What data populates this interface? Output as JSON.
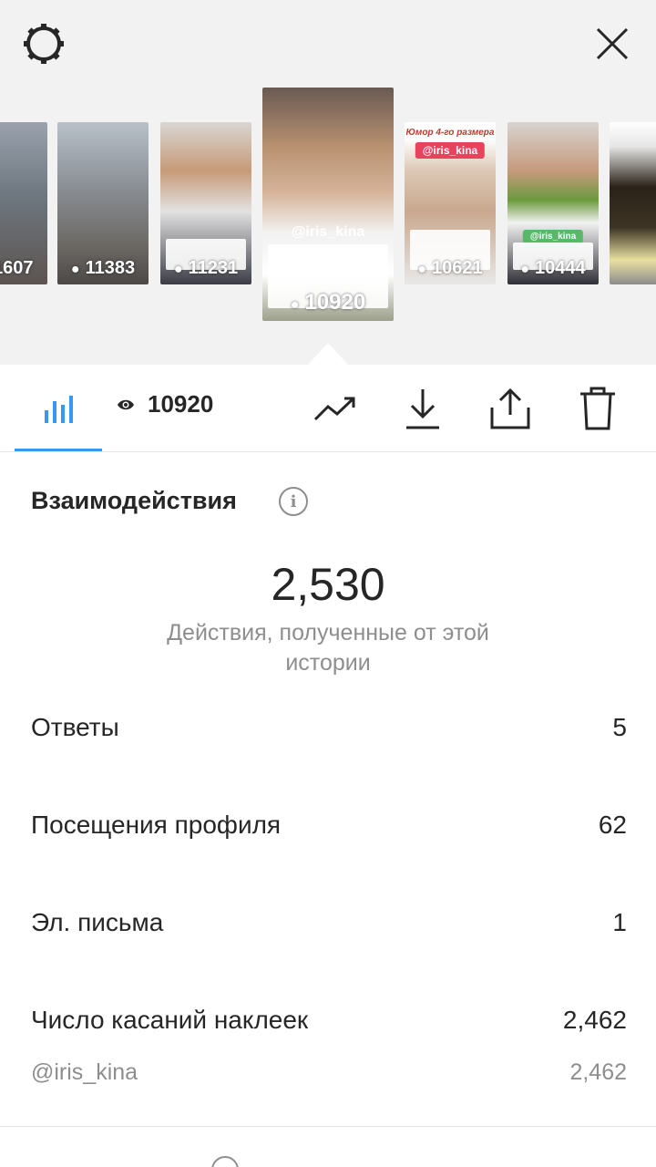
{
  "header": {
    "settings_icon": "gear-icon",
    "close_icon": "close-icon"
  },
  "stories": [
    {
      "views": "1607"
    },
    {
      "views": "11383"
    },
    {
      "views": "11231"
    },
    {
      "views": "10920",
      "tag": "@iris_kina"
    },
    {
      "views": "10621",
      "tag": "@iris_kina",
      "title": "Юмор 4-го размера"
    },
    {
      "views": "10444",
      "tag": "@iris_kina"
    },
    {
      "views": ""
    }
  ],
  "toolbar": {
    "views": "10920"
  },
  "interactions": {
    "title": "Взаимодействия",
    "total": "2,530",
    "total_label": "Действия, полученные от этой истории",
    "rows": [
      {
        "label": "Ответы",
        "value": "5"
      },
      {
        "label": "Посещения профиля",
        "value": "62"
      },
      {
        "label": "Эл. письма",
        "value": "1"
      },
      {
        "label": "Число касаний наклеек",
        "value": "2,462"
      }
    ],
    "sticker": {
      "label": "@iris_kina",
      "value": "2,462"
    }
  },
  "colors": {
    "accent": "#3897f0",
    "tray_bg": "#f2f2f2",
    "muted": "#8e8e8e"
  }
}
